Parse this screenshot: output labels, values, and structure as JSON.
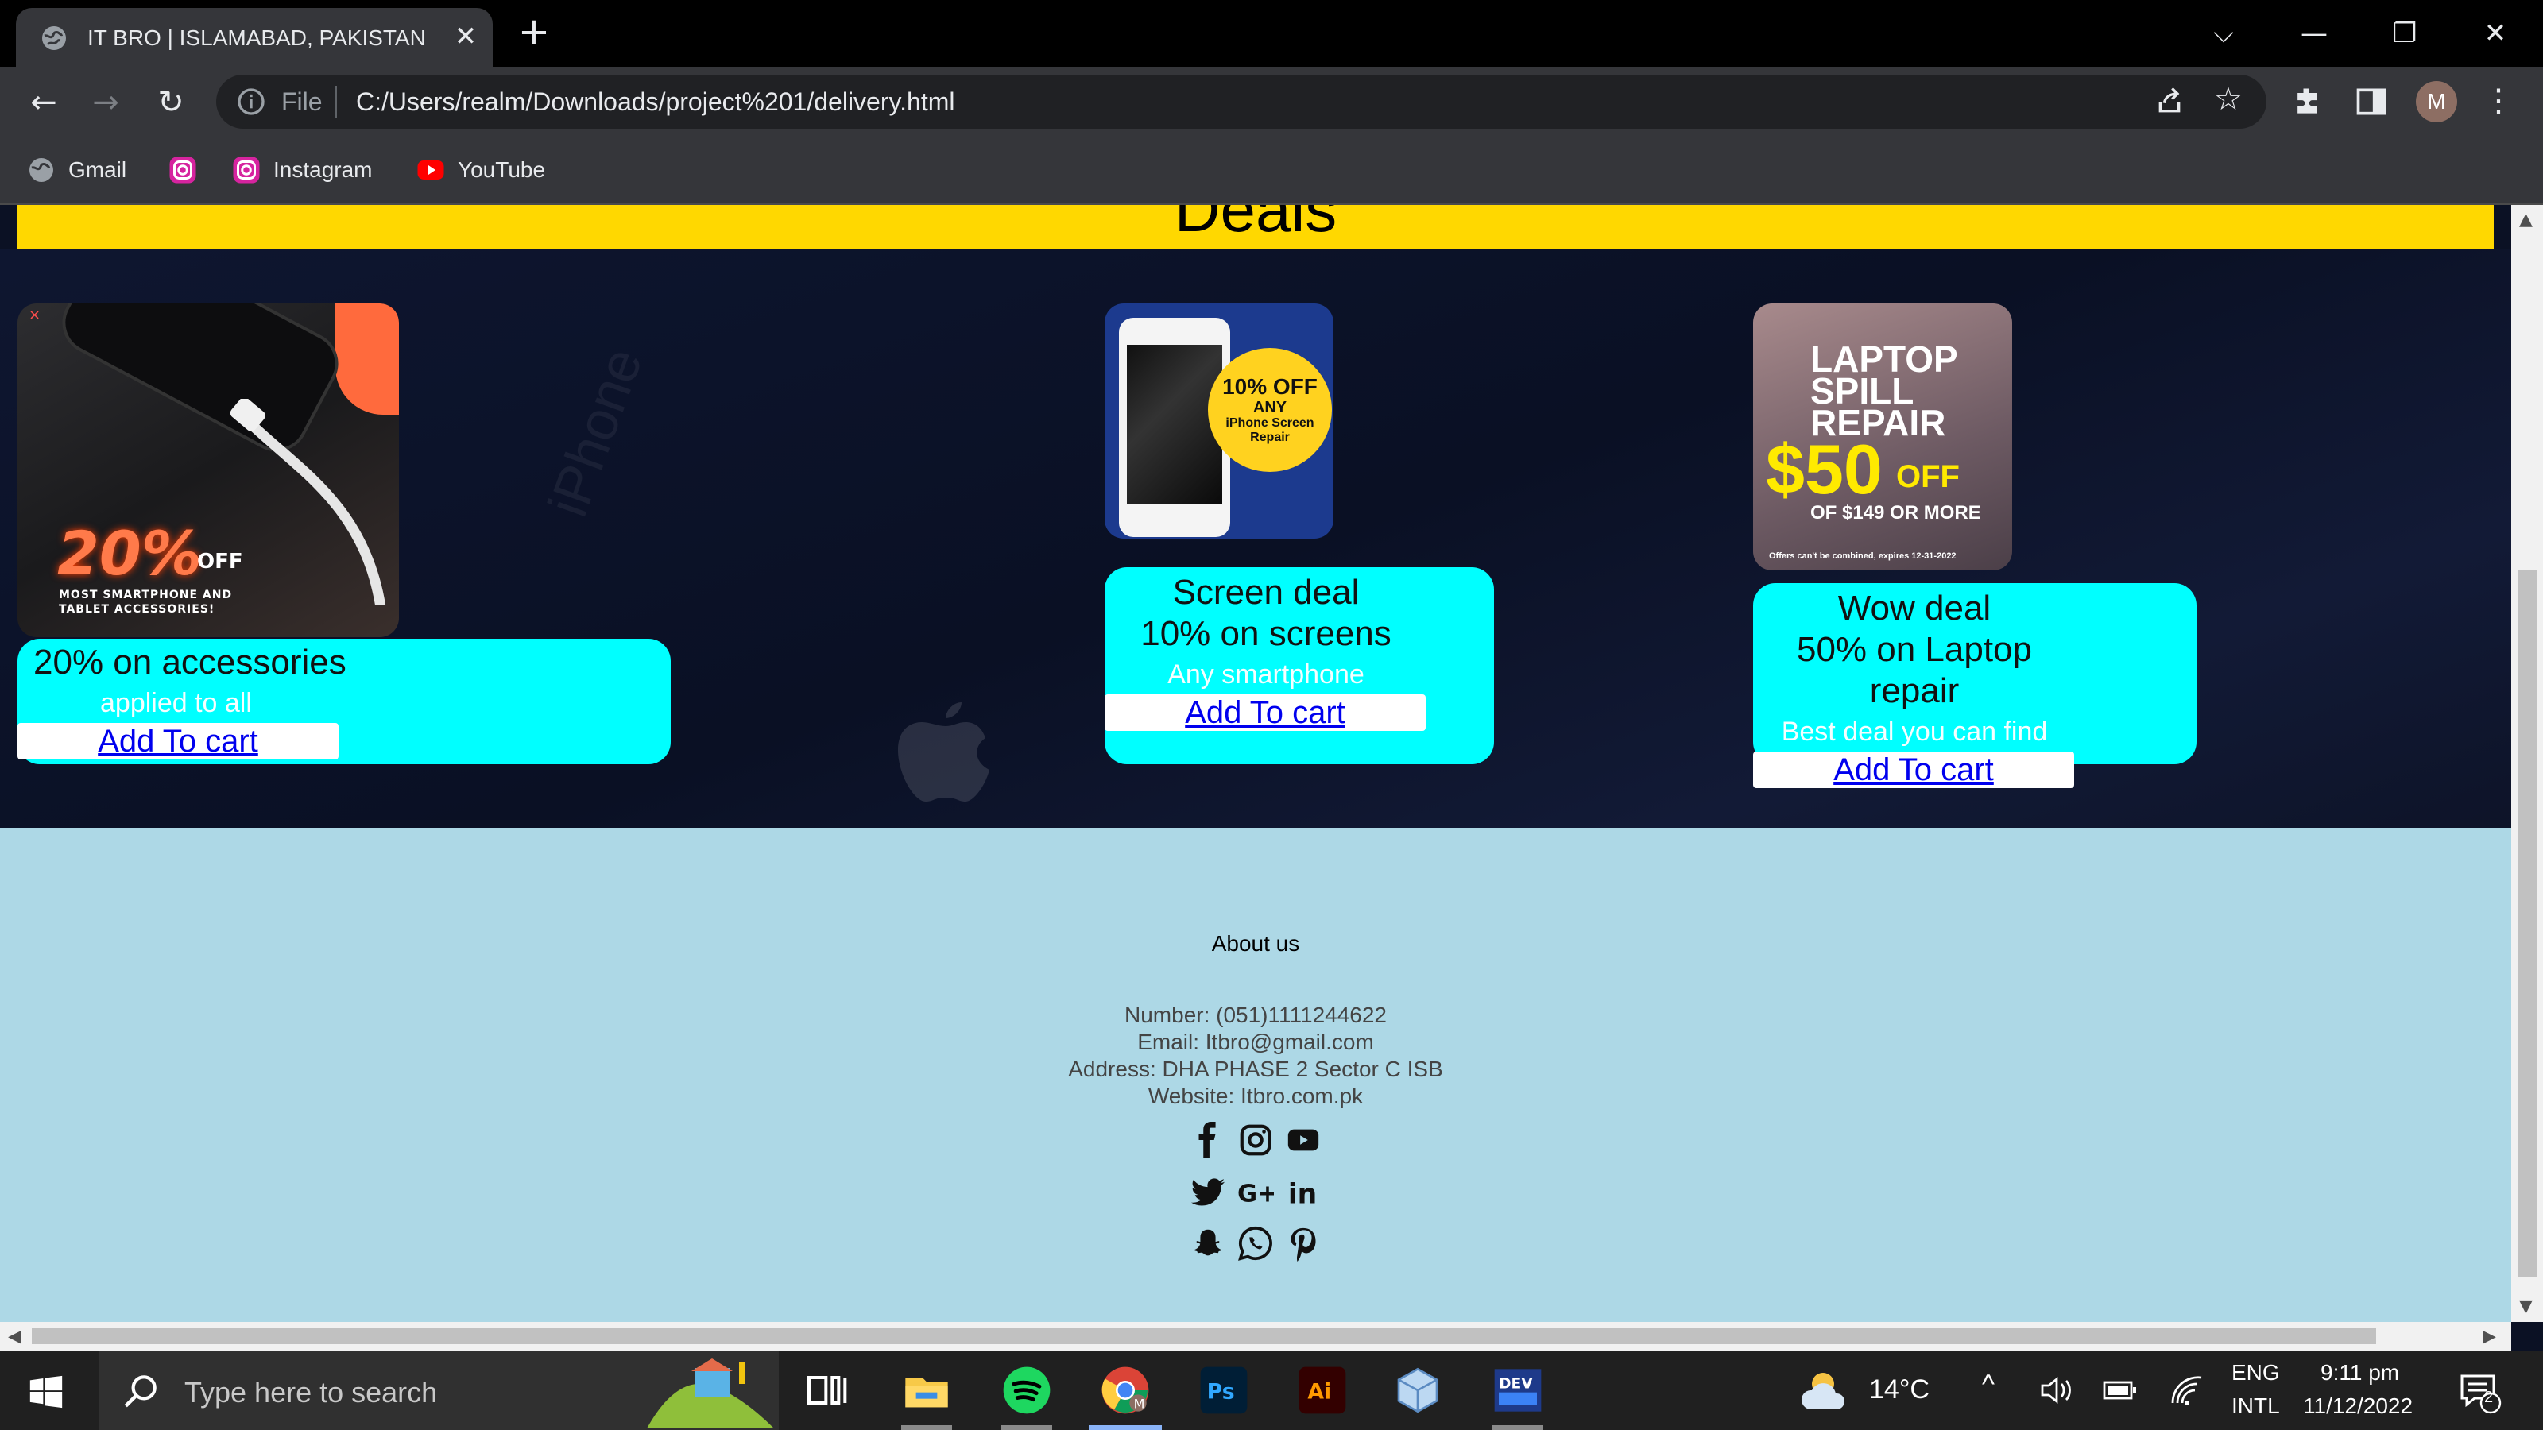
{
  "browser": {
    "tab_title": "IT BRO | ISLAMABAD, PAKISTAN",
    "file_label": "File",
    "url": "C:/Users/realm/Downloads/project%201/delivery.html",
    "profile_initial": "M",
    "bookmarks": [
      {
        "label": "Gmail",
        "icon": "globe-icon"
      },
      {
        "label": "",
        "icon": "instagram-icon"
      },
      {
        "label": "Instagram",
        "icon": "instagram-icon"
      },
      {
        "label": "YouTube",
        "icon": "youtube-icon"
      }
    ]
  },
  "page": {
    "section_heading": "Deals",
    "watermark": "iPhone",
    "deals": [
      {
        "image_text_big": "20%",
        "image_text_off": "OFF",
        "image_text_small": "MOST SMARTPHONE AND TABLET ACCESSORIES!",
        "title": "20% on accessories",
        "subtitle": "applied to all",
        "button": "Add To cart"
      },
      {
        "image_text_big": "10% OFF",
        "image_text_mid": "ANY",
        "image_text_small": "iPhone Screen Repair",
        "title_line1": "Screen deal",
        "title_line2": "10% on screens",
        "subtitle": "Any smartphone",
        "button": "Add To cart"
      },
      {
        "image_text_big": "LAPTOP SPILL REPAIR",
        "image_price": "$50",
        "image_off": "OFF",
        "image_cond": "OF $149 OR MORE",
        "image_fine": "Offers can't be combined, expires 12-31-2022",
        "title_line1": "Wow deal",
        "title_line2": "50% on Laptop repair",
        "subtitle": "Best deal you can find",
        "button": "Add To cart"
      }
    ],
    "footer": {
      "about": "About us",
      "number": "Number: (051)1111244622",
      "email": "Email: Itbro@gmail.com",
      "address": "Address: DHA PHASE 2 Sector C ISB",
      "website": "Website: Itbro.com.pk",
      "social_icons": [
        [
          "facebook-icon",
          "instagram-icon",
          "youtube-icon"
        ],
        [
          "twitter-icon",
          "google-plus-icon",
          "linkedin-icon"
        ],
        [
          "snapchat-icon",
          "whatsapp-icon",
          "pinterest-icon"
        ]
      ]
    }
  },
  "taskbar": {
    "search_placeholder": "Type here to search",
    "temperature": "14°C",
    "lang_line1": "ENG",
    "lang_line2": "INTL",
    "time": "9:11 pm",
    "date": "11/12/2022",
    "notification_count": "2",
    "apps": [
      "task-view-icon",
      "file-explorer-icon",
      "spotify-icon",
      "chrome-icon",
      "photoshop-icon",
      "illustrator-icon",
      "virtualbox-icon",
      "dev-icon"
    ]
  },
  "colors": {
    "deals_band": "#ffd800",
    "card_bg": "#00ffff",
    "footer_bg": "#add8e6",
    "link": "#0000ee"
  }
}
